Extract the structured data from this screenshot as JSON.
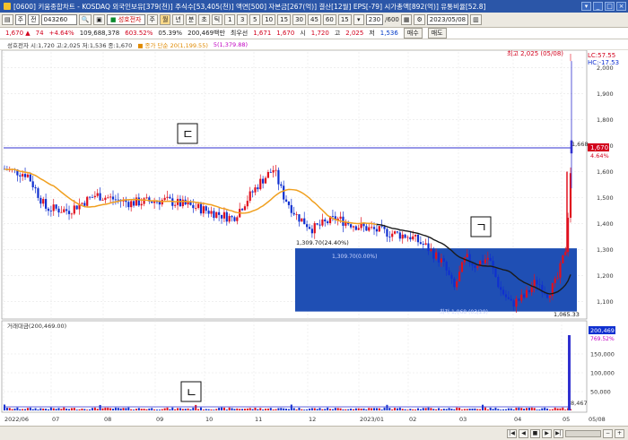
{
  "title": "[0600] 키움종합차트 - KOSDAQ 외국인보유[379(천)] 주식수[53,405(천)] 액면[500] 자본금[267(억)] 결산[12월] EPS[-79] 시가총액[892(억)] 유통비율[52.8]",
  "toolbar": {
    "period_select": "주",
    "type_select": "전",
    "code": "043260",
    "stock_name": "성호전자",
    "buttons": [
      "주",
      "월",
      "년",
      "분",
      "초",
      "틱"
    ],
    "active_button": "월",
    "intervals": [
      "1",
      "3",
      "5",
      "10",
      "15",
      "30",
      "45",
      "60",
      "15"
    ],
    "count": "230",
    "count_max": "600",
    "date": "2023/05/08"
  },
  "quote": {
    "price": "1,670",
    "change": "74",
    "change_pct": "+4.64%",
    "volume": "109,688,378",
    "vol_pct": "603.52%",
    "turnover": "05.39%",
    "amount": "200,469백만",
    "best_label": "최우선",
    "bid": "1,671",
    "ask": "1,670",
    "high_label": "시",
    "open": "1,720",
    "hi_label": "고",
    "high": "2,025",
    "lo_label": "저",
    "low": "1,536",
    "buy_btn": "매수",
    "sell_btn": "매도"
  },
  "legend": {
    "main": "성호전자 시:1,720 고:2,025 저:1,536 종:1,670",
    "ma1": "■ 종가 단순 20(1,199.55)",
    "ma2": "5(1,379.88)"
  },
  "chart_data": {
    "type": "candlestick",
    "price_axis": {
      "ticks": [
        "2,000",
        "1,900",
        "1,800",
        "1,700",
        "1,600",
        "1,500",
        "1,400",
        "1,300",
        "1,200",
        "1,100"
      ],
      "range": [
        1040,
        2060
      ]
    },
    "volume_axis": {
      "ticks": [
        "150,000",
        "100,000",
        "50,000"
      ],
      "range": [
        0,
        200000
      ]
    },
    "x_ticks": [
      "2022/06",
      "07",
      "08",
      "09",
      "10",
      "11",
      "12",
      "2023/01",
      "02",
      "03",
      "04",
      "05",
      "05/08"
    ],
    "annotations": {
      "high": "최고 2,025 (05/08)",
      "low_box": "1,065.33",
      "box_left": "1,309.70(24.40%)",
      "mid_label": "1,309.70(0.00%)",
      "low_label": "최저 1,068 (03/29)",
      "lc": "LC:57.55",
      "hc": "HC:-17.53",
      "current": "1,670",
      "current_pct": "4.64%",
      "hline_label": "1,668",
      "vol_label": "200,469",
      "vol_pct": "769.52%",
      "vol_small": "8,467",
      "vol_legend": "거래대금(200,469.00)"
    },
    "markers": [
      "ㄷ",
      "ㄱ",
      "ㄴ"
    ],
    "colors": {
      "up": "#e0101e",
      "down": "#1030d0",
      "ma20": "#f0a020",
      "ma_dark": "#1a1a1a",
      "box": "#1f4fb4",
      "hline": "#3030d0"
    }
  }
}
